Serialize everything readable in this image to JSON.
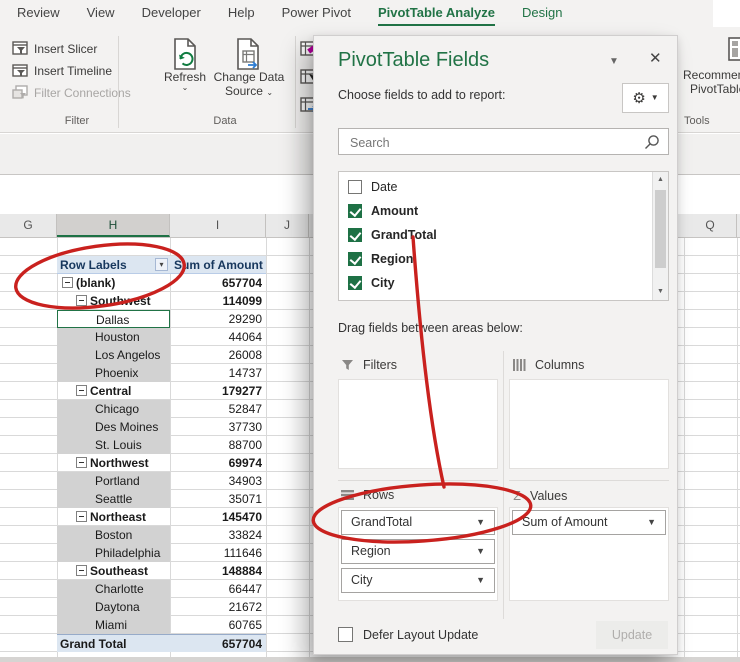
{
  "tabs": {
    "active": "PivotTable Analyze",
    "items": [
      {
        "label": "Review",
        "contextual": false
      },
      {
        "label": "View",
        "contextual": false
      },
      {
        "label": "Developer",
        "contextual": false
      },
      {
        "label": "Help",
        "contextual": false
      },
      {
        "label": "Power Pivot",
        "contextual": false
      },
      {
        "label": "PivotTable Analyze",
        "contextual": true
      },
      {
        "label": "Design",
        "contextual": true
      }
    ]
  },
  "ribbon": {
    "filter_group": {
      "label": "Filter",
      "buttons": [
        {
          "label": "Insert Slicer",
          "icon": "insert-slicer-icon",
          "disabled": false
        },
        {
          "label": "Insert Timeline",
          "icon": "insert-timeline-icon",
          "disabled": false
        },
        {
          "label": "Filter Connections",
          "icon": "filter-connections-icon",
          "disabled": true
        }
      ]
    },
    "data_group": {
      "label": "Data",
      "refresh_label": "Refresh",
      "change_source_line1": "Change Data",
      "change_source_line2": "Source"
    },
    "tools_group": {
      "label": "Tools",
      "recommended_line1": "Recommended",
      "recommended_line2": "PivotTables"
    }
  },
  "sheet": {
    "column_headers": [
      {
        "label": "G",
        "selected": false
      },
      {
        "label": "H",
        "selected": true
      },
      {
        "label": "I",
        "selected": false
      },
      {
        "label": "J",
        "selected": false
      },
      {
        "label": "Q",
        "selected": false
      }
    ],
    "pivot": {
      "header": {
        "row_label": "Row Labels",
        "value_label": "Sum of Amount"
      },
      "rows": [
        {
          "label": "(blank)",
          "value": "657704",
          "type": "g0"
        },
        {
          "label": "Southwest",
          "value": "114099",
          "type": "g1"
        },
        {
          "label": "Dallas",
          "value": "29290",
          "type": "city",
          "active": true
        },
        {
          "label": "Houston",
          "value": "44064",
          "type": "city"
        },
        {
          "label": "Los Angelos",
          "value": "26008",
          "type": "city"
        },
        {
          "label": "Phoenix",
          "value": "14737",
          "type": "city"
        },
        {
          "label": "Central",
          "value": "179277",
          "type": "g1"
        },
        {
          "label": "Chicago",
          "value": "52847",
          "type": "city"
        },
        {
          "label": "Des Moines",
          "value": "37730",
          "type": "city"
        },
        {
          "label": "St. Louis",
          "value": "88700",
          "type": "city"
        },
        {
          "label": "Northwest",
          "value": "69974",
          "type": "g1"
        },
        {
          "label": "Portland",
          "value": "34903",
          "type": "city"
        },
        {
          "label": "Seattle",
          "value": "35071",
          "type": "city"
        },
        {
          "label": "Northeast",
          "value": "145470",
          "type": "g1"
        },
        {
          "label": "Boston",
          "value": "33824",
          "type": "city"
        },
        {
          "label": "Philadelphia",
          "value": "111646",
          "type": "city"
        },
        {
          "label": "Southeast",
          "value": "148884",
          "type": "g1"
        },
        {
          "label": "Charlotte",
          "value": "66447",
          "type": "city"
        },
        {
          "label": "Daytona",
          "value": "21672",
          "type": "city"
        },
        {
          "label": "Miami",
          "value": "60765",
          "type": "city"
        },
        {
          "label": "Grand Total",
          "value": "657704",
          "type": "grand"
        }
      ]
    }
  },
  "pane": {
    "title": "PivotTable Fields",
    "choose_label": "Choose fields to add to report:",
    "search_placeholder": "Search",
    "fields": [
      {
        "name": "Date",
        "checked": false
      },
      {
        "name": "Amount",
        "checked": true
      },
      {
        "name": "GrandTotal",
        "checked": true
      },
      {
        "name": "Region",
        "checked": true
      },
      {
        "name": "City",
        "checked": true
      }
    ],
    "drag_label": "Drag fields between areas below:",
    "areas": {
      "filters": {
        "label": "Filters",
        "chips": []
      },
      "columns": {
        "label": "Columns",
        "chips": []
      },
      "rows": {
        "label": "Rows",
        "chips": [
          "GrandTotal",
          "Region",
          "City"
        ]
      },
      "values": {
        "label": "Values",
        "chips": [
          "Sum of Amount"
        ]
      }
    },
    "defer_label": "Defer Layout Update",
    "update_label": "Update"
  },
  "annotations": {
    "color": "#c9211e",
    "items": [
      "ellipse around Row Labels and (blank)",
      "ellipse around GrandTotal rows chip",
      "arrow from GrandTotal field to Rows area"
    ]
  },
  "accent_colors": {
    "excel_green": "#217346",
    "selection_gray": "#d2d2d2",
    "pivot_blue": "#dce6f1"
  }
}
